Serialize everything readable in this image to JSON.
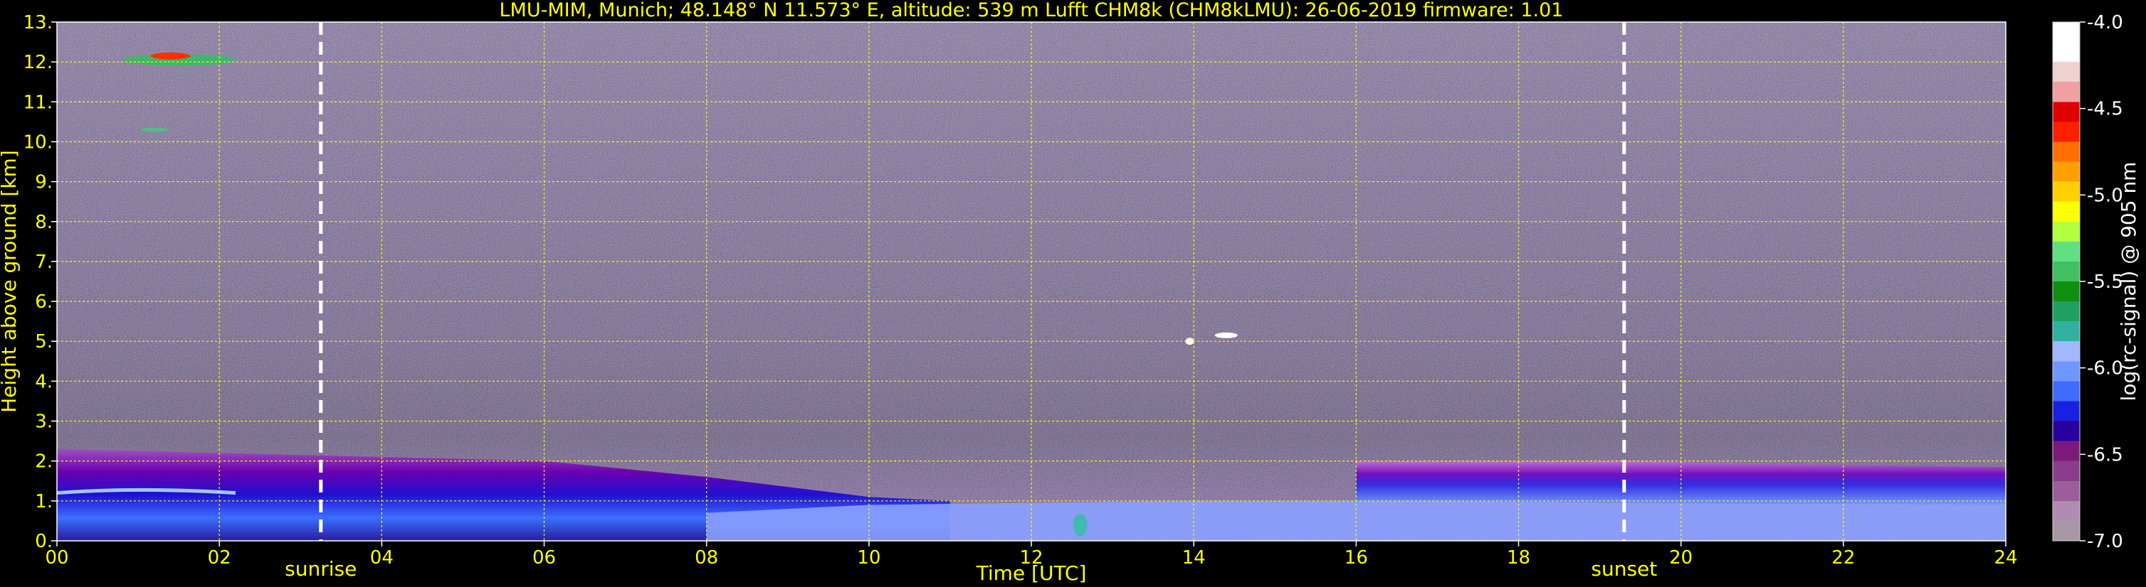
{
  "chart_data": {
    "type": "heatmap",
    "title": "LMU-MIM, Munich; 48.148° N 11.573° E, altitude: 539 m    Lufft CHM8k (CHM8kLMU): 26-06-2019    firmware: 1.01",
    "xlabel": "Time [UTC]",
    "ylabel": "Height above ground [km]",
    "xlim": [
      0,
      24
    ],
    "ylim": [
      0,
      13
    ],
    "x_ticks": [
      "00",
      "02",
      "04",
      "06",
      "08",
      "10",
      "12",
      "14",
      "16",
      "18",
      "20",
      "22",
      "24"
    ],
    "y_ticks": [
      "0.",
      "1.",
      "2.",
      "3.",
      "4.",
      "5.",
      "6.",
      "7.",
      "8.",
      "9.",
      "10.",
      "11.",
      "12.",
      "13."
    ],
    "grid": true,
    "grid_color": "#ffff00",
    "markers": [
      {
        "label": "sunrise",
        "x": 3.25
      },
      {
        "label": "sunset",
        "x": 19.3
      }
    ],
    "colorbar": {
      "label": "log(rc-signal) @ 905 nm",
      "min": -7.0,
      "max": -4.0,
      "ticks": [
        "-4.0",
        "-4.5",
        "-5.0",
        "-5.5",
        "-6.0",
        "-6.5",
        "-7.0"
      ],
      "tick_values": [
        -4.0,
        -4.5,
        -5.0,
        -5.5,
        -6.0,
        -6.5,
        -7.0
      ],
      "colors": [
        "#a797a7",
        "#b18bb1",
        "#9a5f9a",
        "#8a3d8a",
        "#7a1a7a",
        "#2a00a0",
        "#1a20e0",
        "#3d6cff",
        "#6f98ff",
        "#a0b8ff",
        "#30b0a0",
        "#20a060",
        "#109010",
        "#40c060",
        "#60e080",
        "#b0ff40",
        "#ffff00",
        "#ffd000",
        "#ffa000",
        "#ff7000",
        "#ff2000",
        "#e00000",
        "#f0a0a0",
        "#f0d0d0",
        "#ffffff",
        "#ffffff"
      ]
    },
    "features": [
      {
        "name": "aerosol-layer",
        "x_range": [
          0,
          24
        ],
        "height_km": [
          0,
          2.3
        ]
      },
      {
        "name": "cirrus-cloud",
        "x_range": [
          0,
          2.2
        ],
        "height_km": [
          11.8,
          12.3
        ]
      },
      {
        "name": "mid-cloud",
        "x_range": [
          13.9,
          14.6
        ],
        "height_km": [
          4.9,
          5.3
        ]
      }
    ]
  }
}
